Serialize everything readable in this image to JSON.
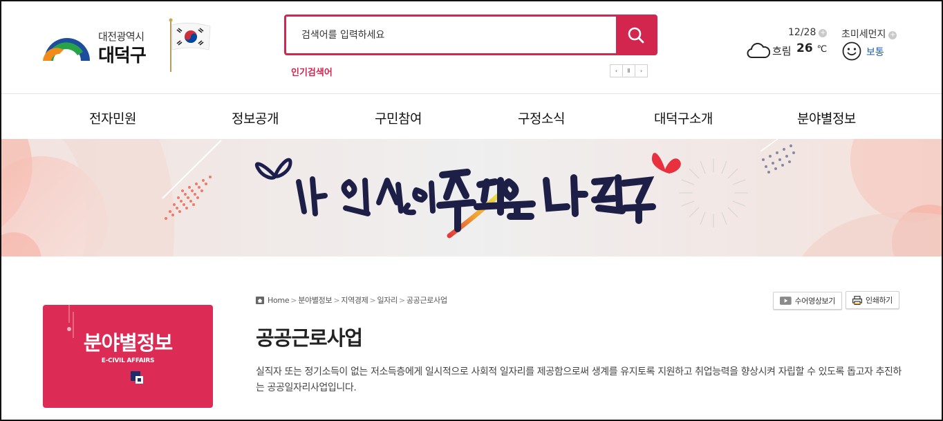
{
  "header": {
    "logo_sub": "대전광역시",
    "logo_main": "대덕구",
    "search": {
      "placeholder": "검색어를 입력하세요",
      "popular_label": "인기검색어"
    },
    "rolling_controls": [
      "‹",
      "Ⅱ",
      "›"
    ],
    "weather": {
      "date": "12/28",
      "condition": "흐림",
      "temperature": "26",
      "unit": "℃",
      "icon": "cloud-icon"
    },
    "dust": {
      "title": "초미세먼지",
      "level": "보통",
      "icon": "smile-face-icon"
    }
  },
  "gnb": {
    "items": [
      "전자민원",
      "정보공개",
      "구민참여",
      "구정소식",
      "대덕구소개",
      "분야별정보"
    ]
  },
  "lnb": {
    "title": "분야별정보",
    "subtitle": "E-CIVIL AFFAIRS"
  },
  "breadcrumb": [
    "Home",
    "분야별정보",
    "지역경제",
    "일자리",
    "공공근로사업"
  ],
  "buttons": {
    "sign_video": "수어영상보기",
    "print": "인쇄하기"
  },
  "content": {
    "title": "공공근로사업",
    "description": "실직자 또는 정기소득이 없는 저소득층에게 일시적으로 사회적 일자리를 제공함으로써 생계를 유지토록 지원하고 취업능력을 향상시켜 자립할 수 있도록 돕고자 추진하는 공공일자리사업입니다."
  },
  "colors": {
    "accent": "#d3264e",
    "lnb_bg": "#dc2b54",
    "dust_blue": "#1f5fae"
  }
}
